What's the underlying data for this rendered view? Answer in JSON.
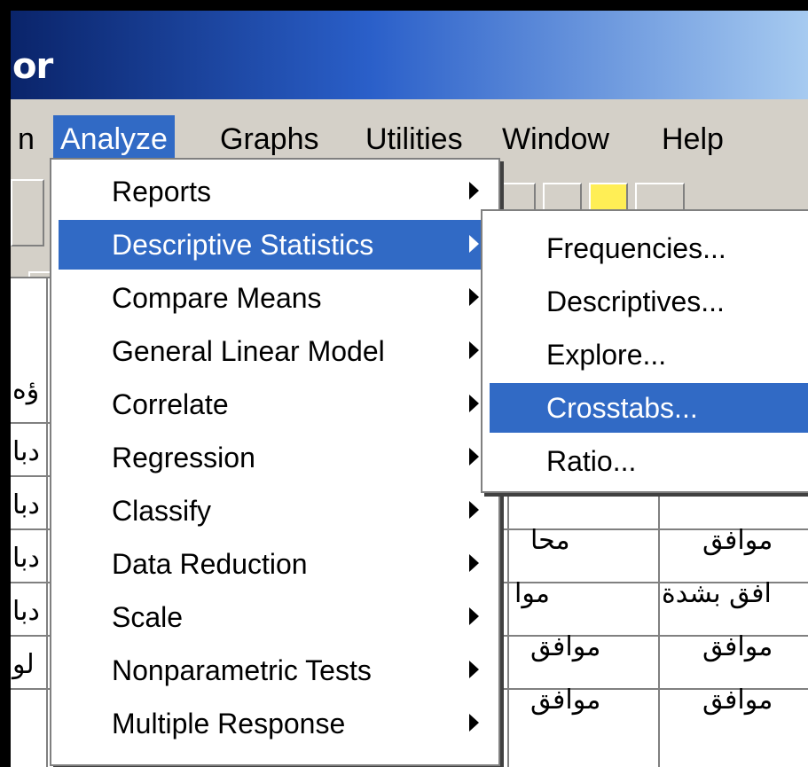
{
  "window": {
    "title_fragment": "or"
  },
  "menubar": {
    "items": [
      {
        "label": "n"
      },
      {
        "label": "Analyze"
      },
      {
        "label": "Graphs"
      },
      {
        "label": "Utilities"
      },
      {
        "label": "Window"
      },
      {
        "label": "Help"
      }
    ]
  },
  "analyze_menu": {
    "items": [
      {
        "label": "Reports"
      },
      {
        "label": "Descriptive Statistics"
      },
      {
        "label": "Compare Means"
      },
      {
        "label": "General Linear Model"
      },
      {
        "label": "Correlate"
      },
      {
        "label": "Regression"
      },
      {
        "label": "Classify"
      },
      {
        "label": "Data Reduction"
      },
      {
        "label": "Scale"
      },
      {
        "label": "Nonparametric Tests"
      },
      {
        "label": "Multiple Response"
      }
    ]
  },
  "descriptive_submenu": {
    "items": [
      {
        "label": "Frequencies..."
      },
      {
        "label": "Descriptives..."
      },
      {
        "label": "Explore..."
      },
      {
        "label": "Crosstabs..."
      },
      {
        "label": "Ratio..."
      }
    ]
  },
  "grid": {
    "left_cells": [
      "ؤه",
      "دبا",
      "دبا",
      "دبا",
      "دبا",
      "لو"
    ],
    "mid_cells": [
      "محا",
      "موا",
      "موافق",
      "موافق"
    ],
    "right_cells": [
      "موافق",
      "افق بشدة",
      "موافق",
      "موافق"
    ]
  },
  "colors": {
    "highlight": "#316ac5",
    "titlebar": "#0a246a",
    "face": "#d4d0c8"
  }
}
